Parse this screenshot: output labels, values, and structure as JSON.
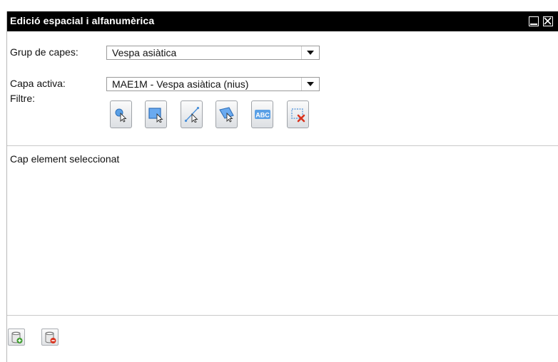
{
  "window": {
    "title": "Edició espacial i alfanumèrica",
    "minimize_icon": "minimize-icon",
    "close_icon": "close-icon"
  },
  "form": {
    "layer_group": {
      "label": "Grup de capes:",
      "value": "Vespa asiàtica"
    },
    "active_layer": {
      "label": "Capa activa:",
      "value": "MAE1M - Vespa asiàtica (nius)"
    },
    "filter": {
      "label": "Filtre:",
      "tools": [
        {
          "name": "select-point-tool",
          "icon": "point-select-icon"
        },
        {
          "name": "select-rectangle-tool",
          "icon": "rectangle-select-icon"
        },
        {
          "name": "select-line-tool",
          "icon": "line-select-icon"
        },
        {
          "name": "select-polygon-tool",
          "icon": "polygon-select-icon"
        },
        {
          "name": "select-text-tool",
          "icon": "abc-text-icon",
          "text": "ABC"
        },
        {
          "name": "clear-selection-tool",
          "icon": "clear-selection-icon"
        }
      ]
    }
  },
  "status": {
    "message": "Cap element seleccionat"
  },
  "footer": {
    "buttons": [
      {
        "name": "add-record-button",
        "icon": "database-add-icon"
      },
      {
        "name": "delete-record-button",
        "icon": "database-remove-icon"
      }
    ]
  },
  "colors": {
    "titlebar": "#000000",
    "accent_blue": "#4a90d9",
    "add_green": "#3a9a2a",
    "remove_red": "#d9341f"
  }
}
